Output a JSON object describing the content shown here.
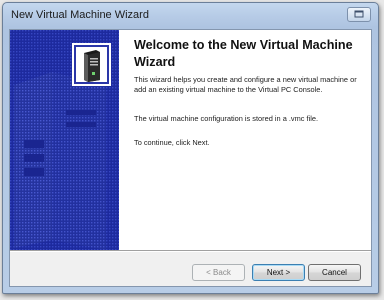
{
  "window": {
    "title": "New Virtual Machine Wizard",
    "control_icon": "window-restore-icon"
  },
  "banner": {
    "icon": "server-computer-icon",
    "background_color": "#1d2a9e"
  },
  "content": {
    "heading": "Welcome to the New Virtual Machine Wizard",
    "paragraph_1": "This wizard helps you create and configure a new virtual machine or add an existing virtual machine to the Virtual PC Console.",
    "paragraph_2": "The virtual machine configuration is stored in a .vmc file.",
    "paragraph_3": "To continue, click Next."
  },
  "buttons": {
    "back_label": "< Back",
    "next_label": "Next >",
    "cancel_label": "Cancel",
    "back_enabled": false
  }
}
